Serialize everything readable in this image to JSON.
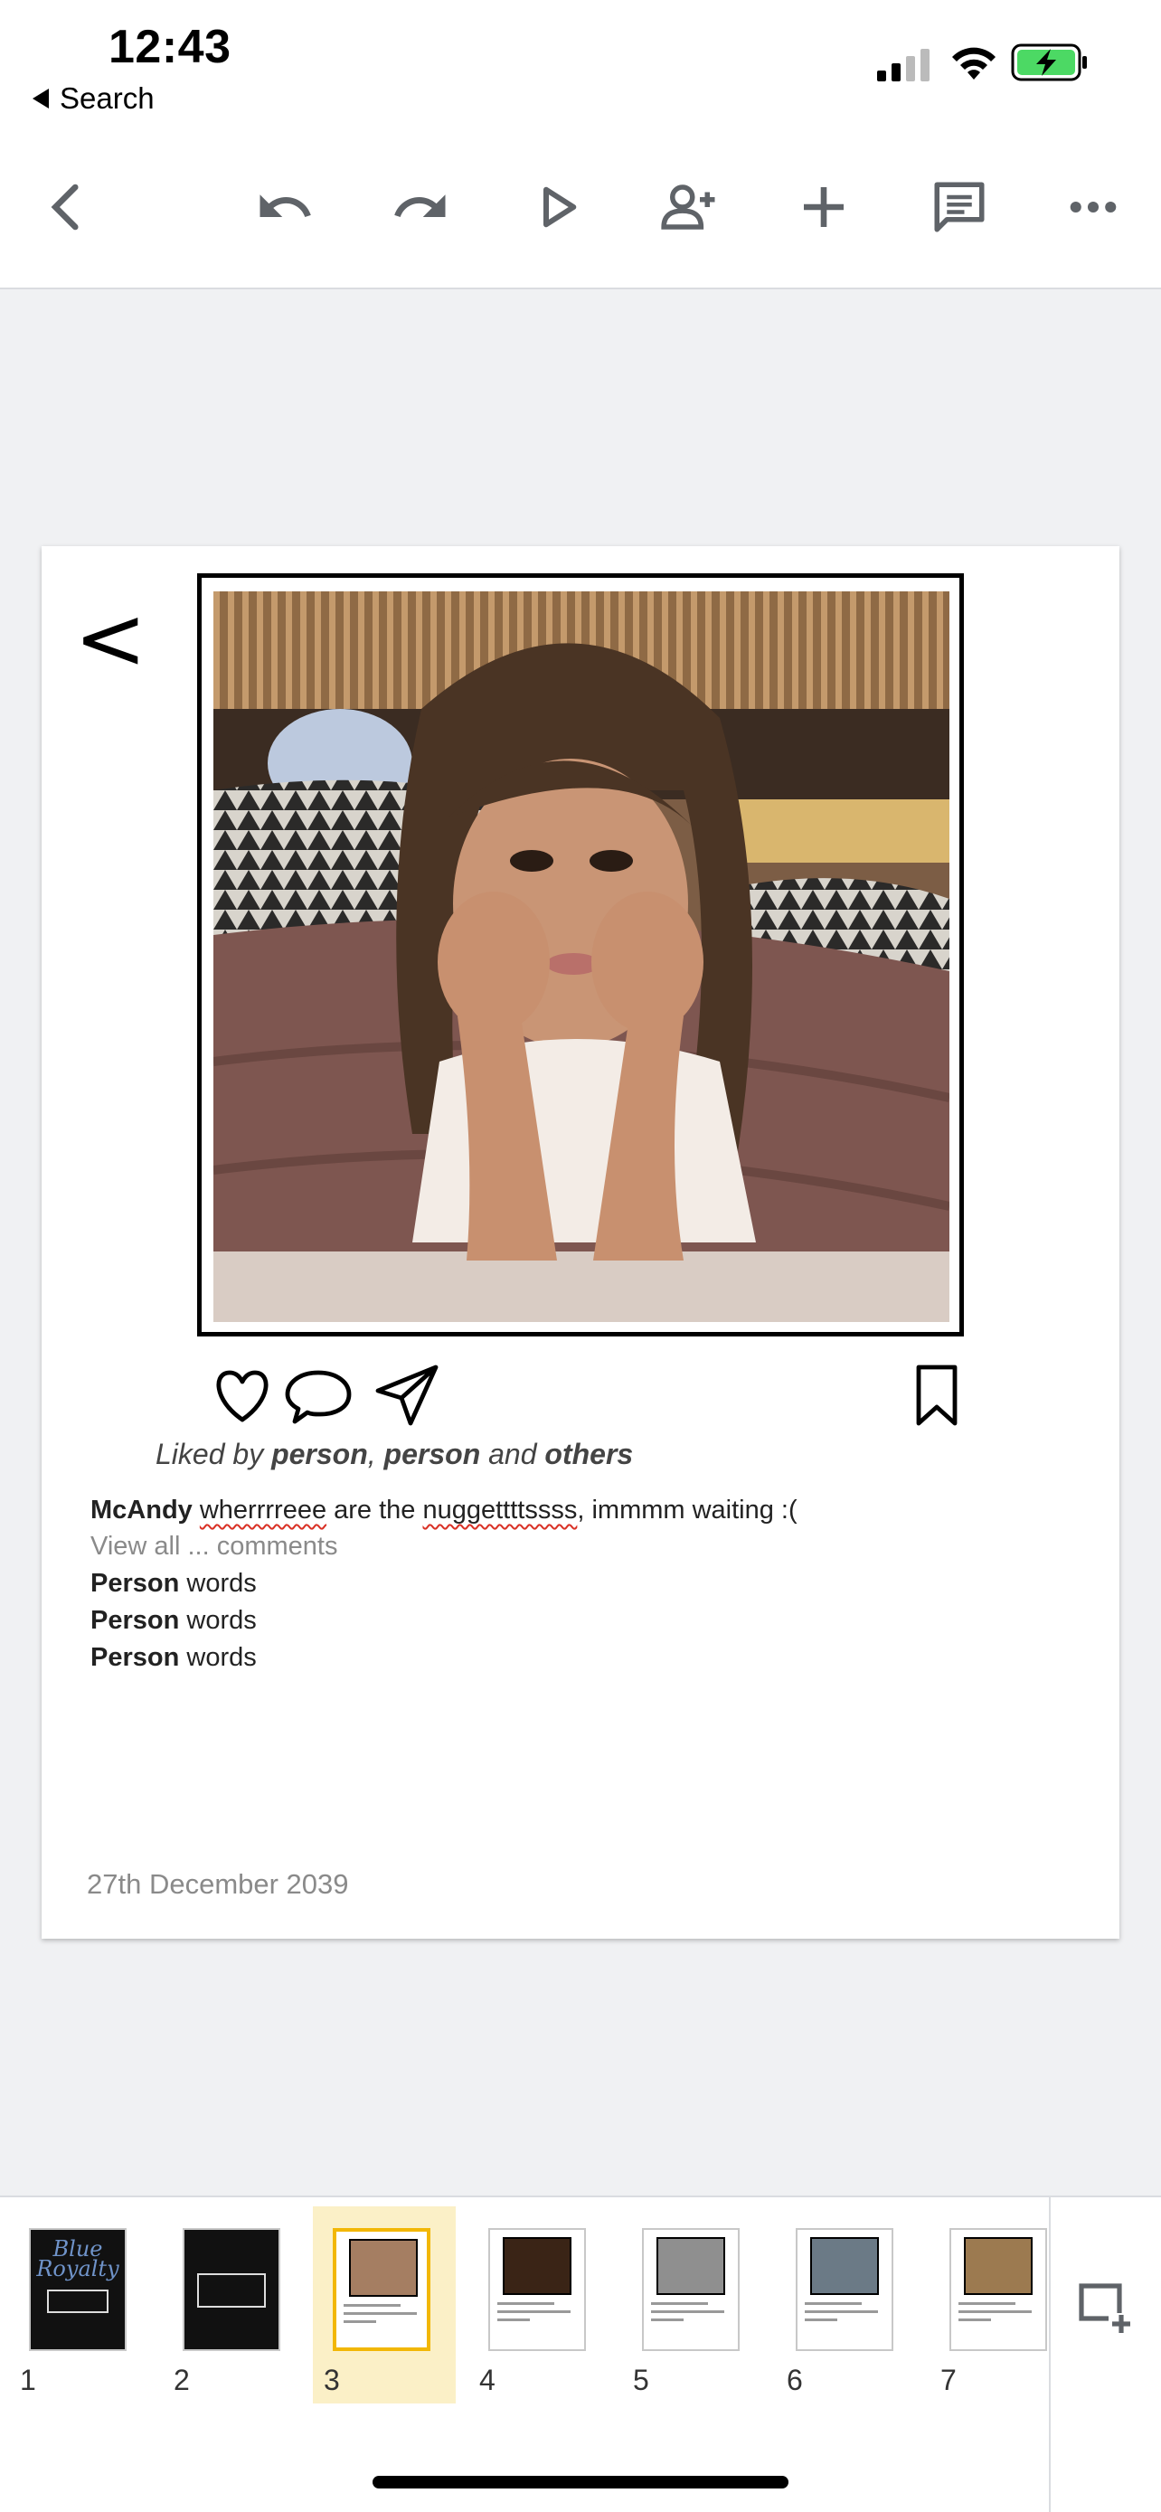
{
  "status_bar": {
    "time": "12:43",
    "back_label": "Search",
    "battery_color": "#4cd964"
  },
  "toolbar": {
    "icons": [
      "chevron-left-icon",
      "undo-icon",
      "redo-icon",
      "play-icon",
      "add-person-icon",
      "plus-icon",
      "comment-icon",
      "more-icon"
    ]
  },
  "slide": {
    "back_glyph": "<",
    "likes": {
      "prefix": "Liked by ",
      "name1": "person",
      "comma": ", ",
      "name2": "person",
      "and": " and ",
      "others": "others"
    },
    "caption": {
      "user": "McAndy",
      "word1": "wherrrreee",
      "mid": " are the ",
      "word2": "nuggettttssss",
      "rest": ", immmm waiting :("
    },
    "view_all": "View all ... comments",
    "comments": [
      {
        "user": "Person",
        "text": " words"
      },
      {
        "user": "Person",
        "text": " words"
      },
      {
        "user": "Person",
        "text": " words"
      }
    ],
    "date": "27th December 2039"
  },
  "filmstrip": {
    "slides": [
      {
        "number": "1",
        "title": "Blue Royalty",
        "selected": false
      },
      {
        "number": "2",
        "selected": false
      },
      {
        "number": "3",
        "selected": true
      },
      {
        "number": "4",
        "selected": false
      },
      {
        "number": "5",
        "selected": false
      },
      {
        "number": "6",
        "selected": false
      },
      {
        "number": "7",
        "selected": false
      }
    ],
    "highlight_color": "#fbf0c7",
    "selected_border_color": "#f2b705"
  }
}
